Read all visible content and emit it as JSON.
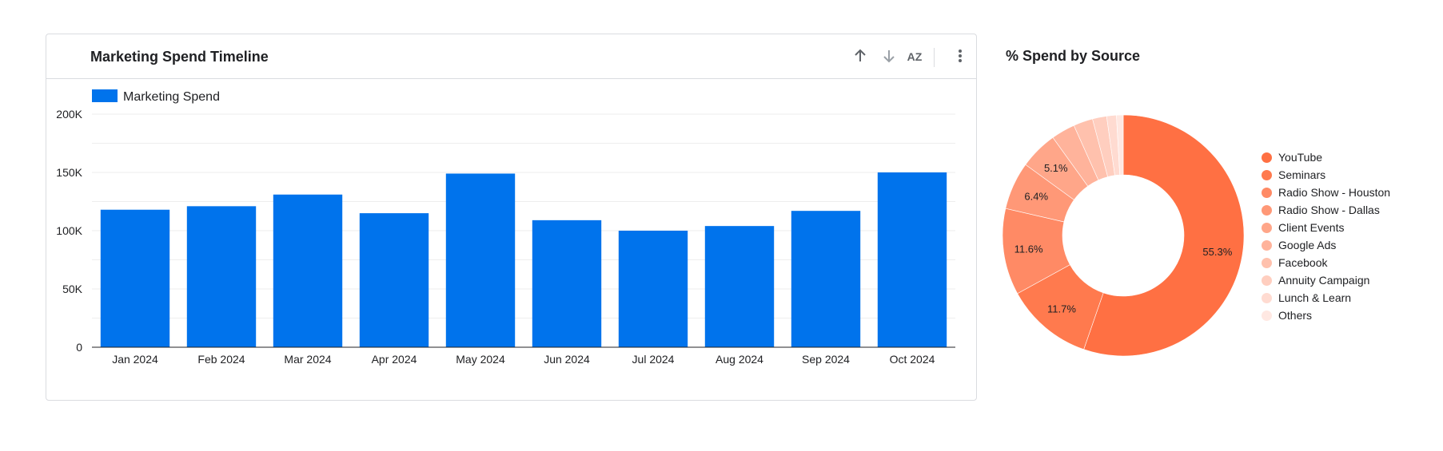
{
  "bar_card": {
    "title": "Marketing Spend Timeline",
    "icons": [
      "arrow-up-icon",
      "arrow-down-icon",
      "sort-az-icon",
      "more-vert-icon"
    ],
    "sort_glyph": "AZ"
  },
  "donut_card": {
    "title": "% Spend by Source"
  },
  "chart_data": [
    {
      "type": "bar",
      "title": "Marketing Spend Timeline",
      "categories": [
        "Jan 2024",
        "Feb 2024",
        "Mar 2024",
        "Apr 2024",
        "May 2024",
        "Jun 2024",
        "Jul 2024",
        "Aug 2024",
        "Sep 2024",
        "Oct 2024"
      ],
      "series": [
        {
          "name": "Marketing Spend",
          "color": "#0073ec",
          "values": [
            118000,
            121000,
            131000,
            115000,
            149000,
            109000,
            100000,
            104000,
            117000,
            150000
          ]
        }
      ],
      "ylim": [
        0,
        200000
      ],
      "yticks": [
        0,
        50000,
        100000,
        150000,
        200000
      ],
      "ytick_labels": [
        "0",
        "50K",
        "100K",
        "150K",
        "200K"
      ],
      "grid": true,
      "legend": "top-left"
    },
    {
      "type": "pie",
      "title": "% Spend by Source",
      "donut": true,
      "legend": "right",
      "slices": [
        {
          "label": "YouTube",
          "value": 55.3,
          "shown_label": "55.3%",
          "color": "#ff7043"
        },
        {
          "label": "Seminars",
          "value": 11.7,
          "shown_label": "11.7%",
          "color": "#ff7a4e"
        },
        {
          "label": "Radio Show - Houston",
          "value": 11.6,
          "shown_label": "11.6%",
          "color": "#ff8a65"
        },
        {
          "label": "Radio Show - Dallas",
          "value": 6.4,
          "shown_label": "6.4%",
          "color": "#ff9877"
        },
        {
          "label": "Client Events",
          "value": 5.1,
          "shown_label": "5.1%",
          "color": "#ffa689"
        },
        {
          "label": "Google Ads",
          "value": 3.2,
          "shown_label": "",
          "color": "#ffb39b"
        },
        {
          "label": "Facebook",
          "value": 2.6,
          "shown_label": "",
          "color": "#ffc1ad"
        },
        {
          "label": "Annuity Campaign",
          "value": 1.9,
          "shown_label": "",
          "color": "#ffcebf"
        },
        {
          "label": "Lunch & Learn",
          "value": 1.3,
          "shown_label": "",
          "color": "#ffdbd1"
        },
        {
          "label": "Others",
          "value": 0.9,
          "shown_label": "",
          "color": "#ffe8e2"
        }
      ]
    }
  ]
}
